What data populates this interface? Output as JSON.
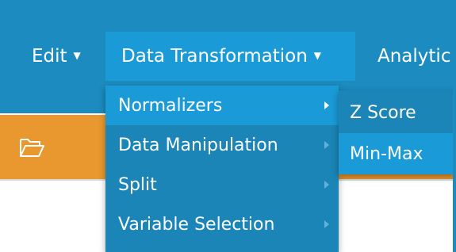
{
  "navbar": {
    "edit_label": "Edit",
    "data_transformation_label": "Data Transformation",
    "analytics_label": "Analytic",
    "caret_glyph": "▼"
  },
  "toolbar": {
    "folder_icon": "folder-open-icon"
  },
  "dropdown": {
    "items": [
      {
        "label": "Normalizers",
        "active": true
      },
      {
        "label": "Data Manipulation",
        "active": false
      },
      {
        "label": "Split",
        "active": false
      },
      {
        "label": "Variable Selection",
        "active": false
      }
    ]
  },
  "submenu": {
    "items": [
      {
        "label": "Z Score",
        "active": false
      },
      {
        "label": "Min-Max",
        "active": true
      }
    ]
  },
  "colors": {
    "nav_blue": "#1c8bbf",
    "active_blue": "#1a9ad6",
    "menu_blue": "#1a85b6",
    "toolbar_orange": "#e8982e"
  }
}
